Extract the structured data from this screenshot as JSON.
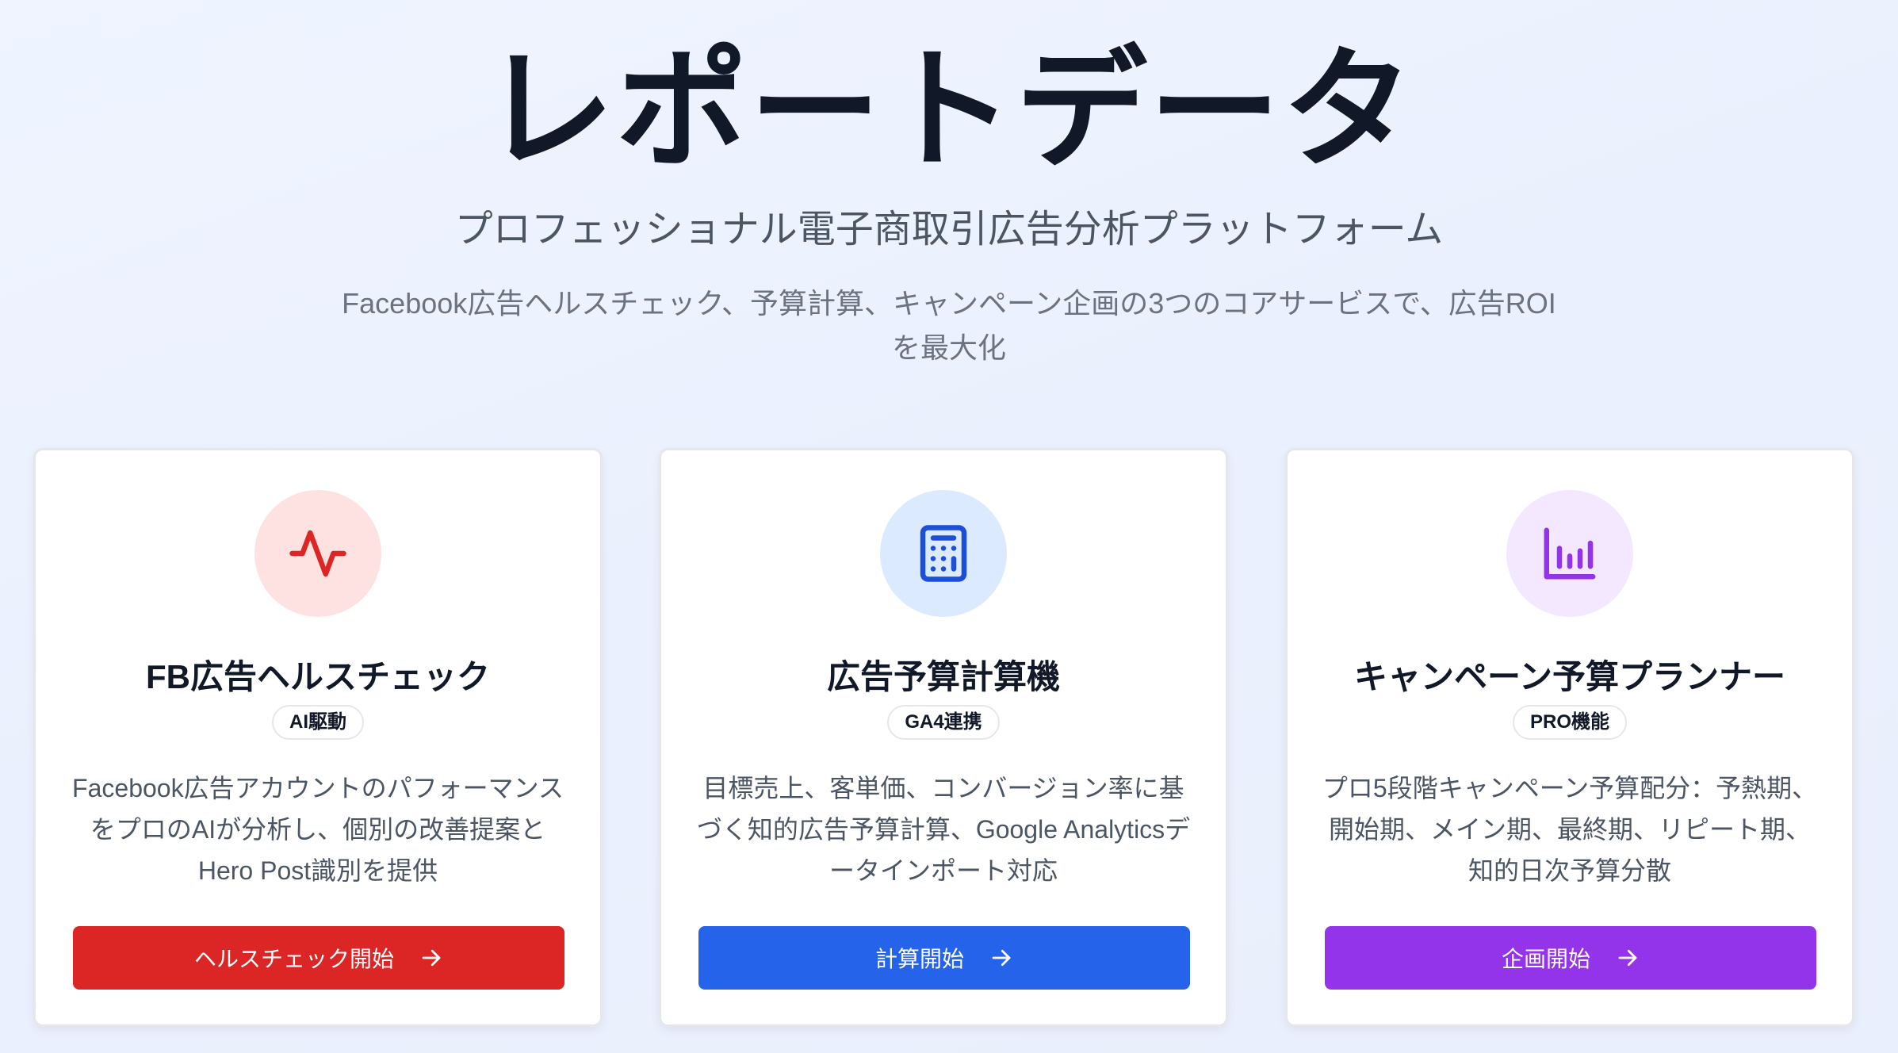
{
  "hero": {
    "title": "レポートデータ",
    "subtitle": "プロフェッショナル電子商取引広告分析プラットフォーム",
    "description": "Facebook広告ヘルスチェック、予算計算、キャンペーン企画の3つのコアサービスで、広告ROIを最大化"
  },
  "cards": [
    {
      "icon": "activity-pulse-icon",
      "icon_color": "#dc2626",
      "icon_bg": "#fee2e2",
      "title": "FB広告ヘルスチェック",
      "badge": "AI駆動",
      "description": "Facebook広告アカウントのパフォーマンスをプロのAIが分析し、個別の改善提案とHero Post識別を提供",
      "button_label": "ヘルスチェック開始",
      "button_color": "#dc2626"
    },
    {
      "icon": "calculator-icon",
      "icon_color": "#1d4ed8",
      "icon_bg": "#dbeafe",
      "title": "広告予算計算機",
      "badge": "GA4連携",
      "description": "目標売上、客単価、コンバージョン率に基づく知的広告予算計算、Google Analyticsデータインポート対応",
      "button_label": "計算開始",
      "button_color": "#2563eb"
    },
    {
      "icon": "bar-chart-icon",
      "icon_color": "#9333ea",
      "icon_bg": "#f3e8ff",
      "title": "キャンペーン予算プランナー",
      "badge": "PRO機能",
      "description": "プロ5段階キャンペーン予算配分：予熱期、開始期、メイン期、最終期、リピート期、知的日次予算分散",
      "button_label": "企画開始",
      "button_color": "#9333ea"
    }
  ]
}
